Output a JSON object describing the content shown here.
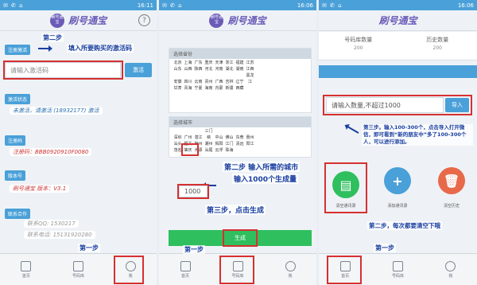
{
  "status": {
    "time": "16:11",
    "time2": "16:06",
    "time3": "16:06",
    "icons": "✉ ✆ ⌂"
  },
  "app": {
    "title": "刷号通宝",
    "logo_text": "刷号通宝"
  },
  "panel1": {
    "step2_note": "第二步",
    "step2_desc": "填入所要购买的激活码",
    "reg_tag": "注册激活",
    "input_placeholder": "请输入激活码",
    "activate_btn": "激活",
    "status_tag": "激活状态",
    "status_value": "未激活，请激活 (18932177) 激活",
    "reg_code_tag": "注册码",
    "reg_code_value": "注册码：BBB0920910F0080",
    "version_tag": "版本号",
    "version_value": "刷号通宝 版本：V3.1",
    "contact_tag": "联系合作",
    "contact_line1": "联系QQ: 1530217",
    "contact_line2": "联系电话: 15131920280",
    "step1_note": "第一步",
    "nav": [
      "首页",
      "号码库",
      "我"
    ]
  },
  "panel2": {
    "province_head": "选择省份",
    "provinces": [
      [
        "北京",
        "上海",
        "广东",
        "重庆",
        "天津",
        "浙江",
        "福建",
        "江苏"
      ],
      [
        "山东",
        "山西",
        "陕西",
        "河北",
        "河南",
        "湖北",
        "湖南",
        "江西"
      ],
      [
        "安徽",
        "四川",
        "云南",
        "贵州",
        "广西",
        "吉林",
        "辽宁",
        "黑龙江"
      ],
      [
        "甘肃",
        "青海",
        "宁夏",
        "海南",
        "内蒙",
        "新疆",
        "西藏"
      ]
    ],
    "city_head": "选择城市",
    "cities": [
      [
        "深圳",
        "广州",
        "湛江",
        "三门峡",
        "中山",
        "佛山",
        "东莞",
        "惠州"
      ],
      [
        "汕头",
        "韶关",
        "梅州",
        "潮州",
        "揭阳",
        "江门",
        "清远",
        "阳江"
      ],
      [
        "茂名",
        "肇庆",
        "河源",
        "汕尾",
        "云浮",
        "珠海"
      ]
    ],
    "step2_note": "第二步 输入所需的城市",
    "step2_note2": "输入1000个生成量",
    "count_value": "1000",
    "step3_note": "第三步，点击生成",
    "generate_btn": "生成",
    "step1_note": "第一步",
    "nav": [
      "首页",
      "号码库",
      "我"
    ]
  },
  "panel3": {
    "tab_left": "号码库数量",
    "tab_left_val": "200",
    "tab_right": "历史数量",
    "tab_right_val": "200",
    "input_placeholder": "请输入数量,不超过1000",
    "import_btn": "导入",
    "step3_note": "第三步。输入100-300个，点击导入打开微信，即可看到“新的朋友中”多了100-300个人，可以进行添加。",
    "btn1_label": "清空通讯录",
    "btn2_label": "添加通讯录",
    "btn3_label": "清空历史",
    "step2_note": "第二步，每次都要清空下哦",
    "step1_note": "第一步",
    "nav": [
      "首页",
      "号码库",
      "我"
    ]
  },
  "colors": {
    "accent": "#4aa0d8",
    "annotation": "#1a3fa0",
    "highlight": "#d63030",
    "green": "#2fbf5e"
  }
}
